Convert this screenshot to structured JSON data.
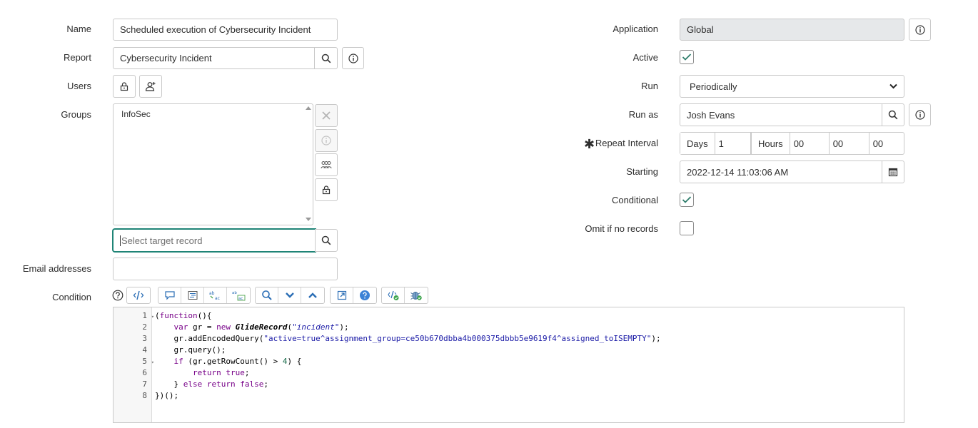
{
  "left": {
    "name": {
      "label": "Name",
      "value": "Scheduled execution of Cybersecurity Incident"
    },
    "report": {
      "label": "Report",
      "value": "Cybersecurity Incident"
    },
    "users": {
      "label": "Users"
    },
    "groups": {
      "label": "Groups",
      "items": [
        "InfoSec"
      ],
      "target_placeholder": "Select target record"
    },
    "email": {
      "label": "Email addresses",
      "value": ""
    },
    "condition": {
      "label": "Condition"
    }
  },
  "right": {
    "application": {
      "label": "Application",
      "value": "Global"
    },
    "active": {
      "label": "Active",
      "checked": true
    },
    "run": {
      "label": "Run",
      "value": "Periodically",
      "options": [
        "Periodically"
      ]
    },
    "run_as": {
      "label": "Run as",
      "value": "Josh Evans"
    },
    "repeat_interval": {
      "label": "Repeat Interval",
      "required_mark": "✱",
      "days_label": "Days",
      "days": "1",
      "hours_label": "Hours",
      "hours": "00",
      "minutes": "00",
      "seconds": "00"
    },
    "starting": {
      "label": "Starting",
      "value": "2022-12-14 11:03:06 AM"
    },
    "conditional": {
      "label": "Conditional",
      "checked": true
    },
    "omit": {
      "label": "Omit if no records",
      "checked": false
    }
  },
  "editor": {
    "line_numbers": [
      "1",
      "2",
      "3",
      "4",
      "5",
      "6",
      "7",
      "8"
    ],
    "code": [
      "(function(){",
      "    var gr = new GlideRecord(\"incident\");",
      "    gr.addEncodedQuery(\"active=true^assignment_group=ce50b670dbba4b000375dbbb5e9619f4^assigned_toISEMPTY\");",
      "    gr.query();",
      "    if (gr.getRowCount() > 4) {",
      "        return true;",
      "    } else return false;",
      "})();"
    ]
  },
  "colors": {
    "accent": "#1f8476",
    "check": "#2e7d6b",
    "border": "#c9c9c9",
    "readonly_bg": "#e6e8ea"
  }
}
